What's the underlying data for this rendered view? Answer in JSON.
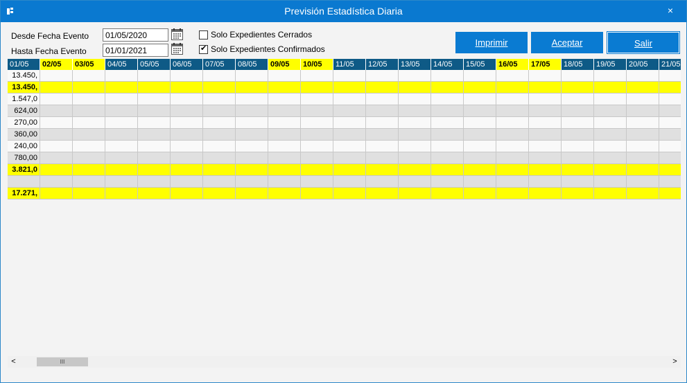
{
  "window": {
    "title": "Previsión Estadística Diaria",
    "close_glyph": "×",
    "app_icon": "app-icon"
  },
  "filters": {
    "desde_label": "Desde Fecha Evento",
    "desde_value": "01/05/2020",
    "hasta_label": "Hasta Fecha Evento",
    "hasta_value": "01/01/2021",
    "calendar_icon": "calendar-icon"
  },
  "options": {
    "cerrados_label": "Solo Expedientes Cerrados",
    "cerrados_checked": false,
    "confirmados_label": "Solo Expedientes Confirmados",
    "confirmados_checked": true
  },
  "buttons": {
    "imprimir": "Imprimir",
    "aceptar": "Aceptar",
    "salir": "Salir"
  },
  "grid": {
    "columns": [
      {
        "label": "01/05",
        "highlight": false
      },
      {
        "label": "02/05",
        "highlight": true
      },
      {
        "label": "03/05",
        "highlight": true
      },
      {
        "label": "04/05",
        "highlight": false
      },
      {
        "label": "05/05",
        "highlight": false
      },
      {
        "label": "06/05",
        "highlight": false
      },
      {
        "label": "07/05",
        "highlight": false
      },
      {
        "label": "08/05",
        "highlight": false
      },
      {
        "label": "09/05",
        "highlight": true
      },
      {
        "label": "10/05",
        "highlight": true
      },
      {
        "label": "11/05",
        "highlight": false
      },
      {
        "label": "12/05",
        "highlight": false
      },
      {
        "label": "13/05",
        "highlight": false
      },
      {
        "label": "14/05",
        "highlight": false
      },
      {
        "label": "15/05",
        "highlight": false
      },
      {
        "label": "16/05",
        "highlight": true
      },
      {
        "label": "17/05",
        "highlight": true
      },
      {
        "label": "18/05",
        "highlight": false
      },
      {
        "label": "19/05",
        "highlight": false
      },
      {
        "label": "20/05",
        "highlight": false
      },
      {
        "label": "21/05",
        "highlight": false
      }
    ],
    "rows": [
      {
        "value": "13.450,",
        "style": "white"
      },
      {
        "value": "13.450,",
        "style": "yellow"
      },
      {
        "value": "1.547,0",
        "style": "white"
      },
      {
        "value": "624,00",
        "style": "grey"
      },
      {
        "value": "270,00",
        "style": "white"
      },
      {
        "value": "360,00",
        "style": "grey"
      },
      {
        "value": "240,00",
        "style": "white"
      },
      {
        "value": "780,00",
        "style": "grey"
      },
      {
        "value": "3.821,0",
        "style": "yellow"
      },
      {
        "value": "",
        "style": "grey"
      },
      {
        "value": "17.271,",
        "style": "yellow"
      }
    ]
  },
  "scrollbar": {
    "left_arrow": "<",
    "right_arrow": ">",
    "thumb_grip": "III"
  }
}
